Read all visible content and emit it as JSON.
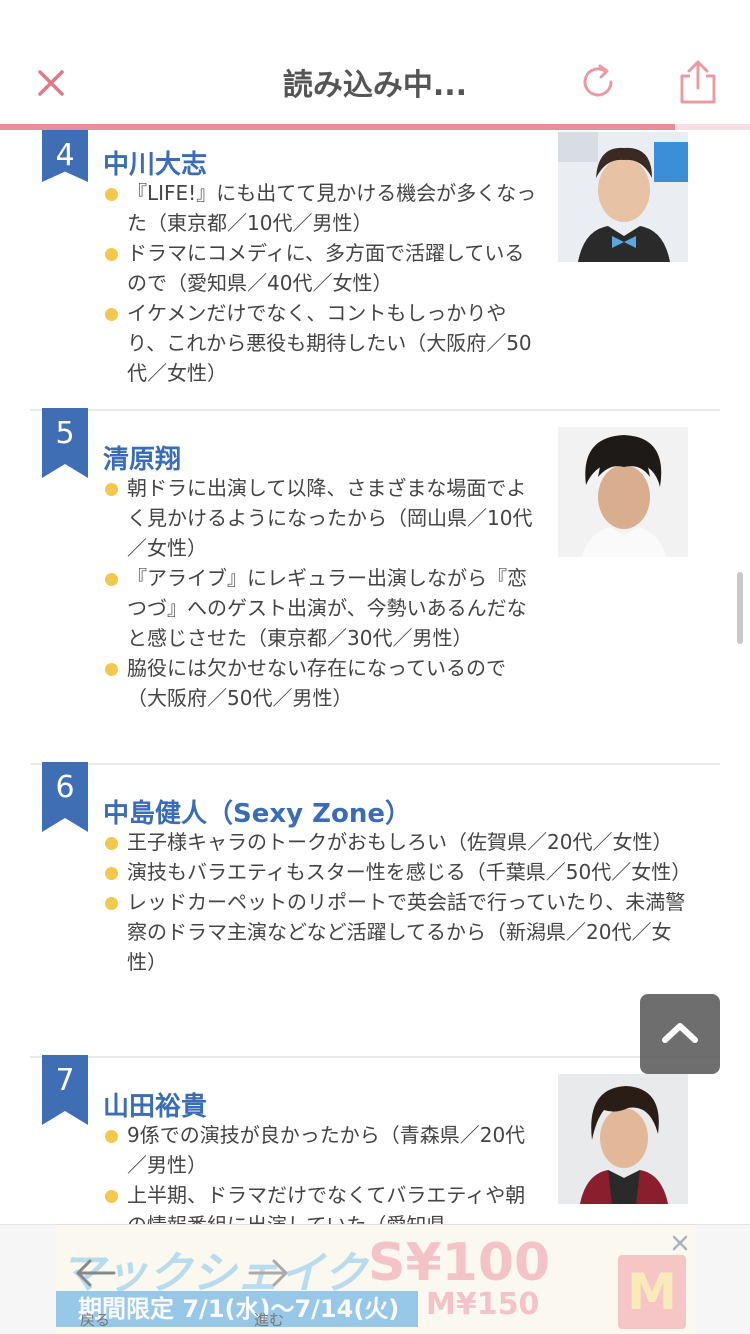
{
  "header": {
    "title": "読み込み中...",
    "progress": 0.9
  },
  "entries": [
    {
      "rank": "4",
      "name": "中川大志",
      "comments": [
        "『LIFE!』にも出てて見かける機会が多くなった（東京都／10代／男性）",
        "ドラマにコメディに、多方面で活躍しているので（愛知県／40代／女性）",
        "イケメンだけでなく、コントもしっかりやり、これから悪役も期待したい（大阪府／50代／女性）"
      ]
    },
    {
      "rank": "5",
      "name": "清原翔",
      "comments": [
        "朝ドラに出演して以降、さまざまな場面でよく見かけるようになったから（岡山県／10代／女性）",
        "『アライブ』にレギュラー出演しながら『恋つづ』へのゲスト出演が、今勢いあるんだなと感じさせた（東京都／30代／男性）",
        "脇役には欠かせない存在になっているので（大阪府／50代／男性）"
      ]
    },
    {
      "rank": "6",
      "name": "中島健人（Sexy Zone）",
      "comments": [
        "王子様キャラのトークがおもしろい（佐賀県／20代／女性）",
        "演技もバラエティもスター性を感じる（千葉県／50代／女性）",
        "レッドカーペットのリポートで英会話で行っていたり、未満警察のドラマ主演などなど活躍してるから（新潟県／20代／女性）"
      ]
    },
    {
      "rank": "7",
      "name": "山田裕貴",
      "comments": [
        "9係での演技が良かったから（青森県／20代／男性）",
        "上半期、ドラマだけでなくてバラエティや朝の情報番組に出演していた（愛知県"
      ]
    }
  ],
  "ad": {
    "line1": "マックシェイク",
    "price1": "S¥100",
    "line2": "期間限定 7/1(水)～7/14(火)",
    "price2": "M¥150",
    "logo": "M"
  },
  "nav": {
    "back_label": "戻る",
    "forward_label": "進む"
  },
  "colors": {
    "accent": "#e88d9a",
    "ribbon": "#3f6eb5",
    "name": "#3a6db5",
    "bullet": "#f2c94c"
  },
  "icons": [
    "close-icon",
    "reload-icon",
    "share-icon",
    "chevron-up-icon",
    "back-arrow-icon",
    "forward-arrow-icon",
    "ad-close-icon"
  ]
}
